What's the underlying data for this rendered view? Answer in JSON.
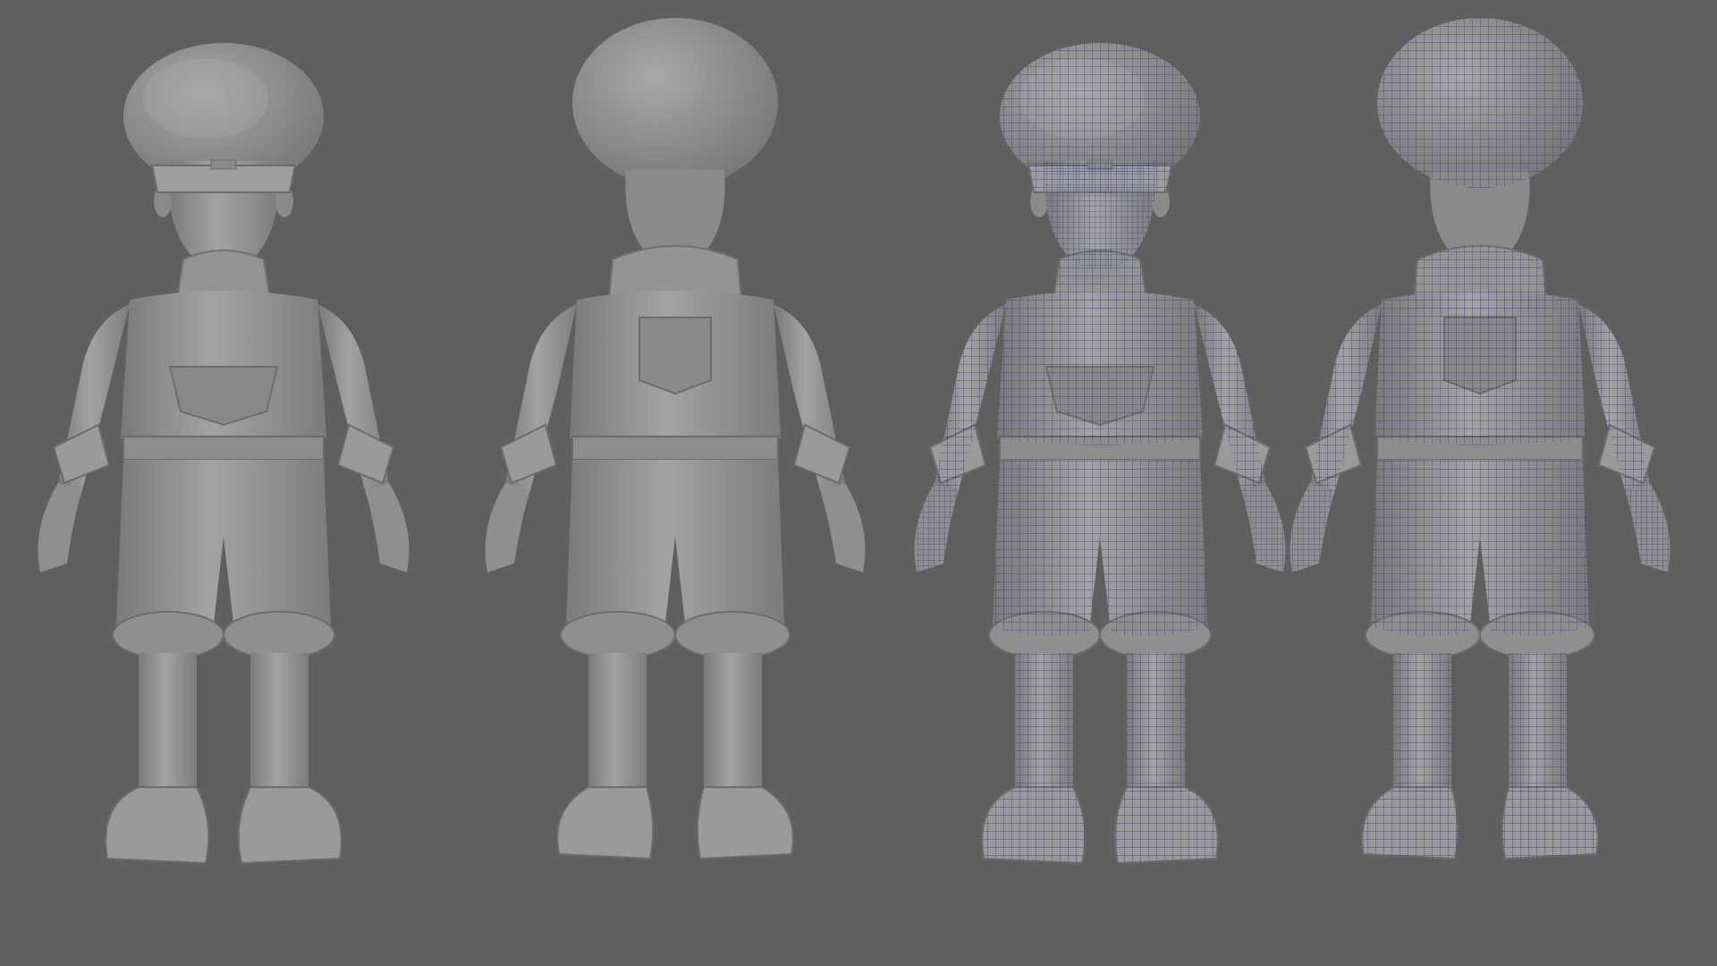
{
  "scene": {
    "background_color": "#5f5f5f",
    "model_color": "#8c8c8c",
    "model_light_color": "#a6a6a6",
    "model_dark_color": "#6e6e6e",
    "wire_color": "#2b2f86",
    "views": [
      {
        "id": "front-shaded",
        "facing": "front",
        "wireframe": false
      },
      {
        "id": "back-shaded",
        "facing": "back",
        "wireframe": false
      },
      {
        "id": "front-wireframe",
        "facing": "front",
        "wireframe": true
      },
      {
        "id": "back-wireframe",
        "facing": "back",
        "wireframe": true
      }
    ]
  }
}
